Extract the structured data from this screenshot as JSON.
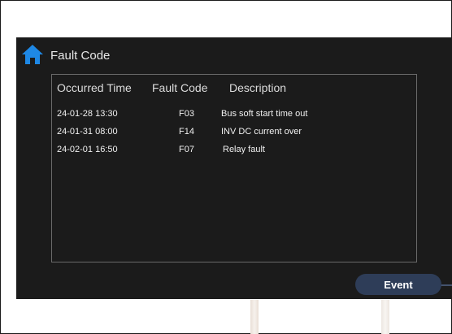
{
  "header": {
    "title": "Fault Code"
  },
  "table": {
    "columns": [
      "Occurred Time",
      "Fault Code",
      "Description"
    ],
    "rows": [
      {
        "time": "24-01-28 13:30",
        "code": "F03",
        "description": "Bus soft start time out"
      },
      {
        "time": "24-01-31 08:00",
        "code": "F14",
        "description": "INV DC current over"
      },
      {
        "time": "24-02-01 16:50",
        "code": "F07",
        "description": "Relay fault"
      }
    ]
  },
  "footer": {
    "event_label": "Event"
  },
  "colors": {
    "screen_bg": "#1b1b1b",
    "accent_blue": "#1e88e5",
    "button_bg": "#2e3d58"
  },
  "icons": {
    "home": "home-icon"
  }
}
